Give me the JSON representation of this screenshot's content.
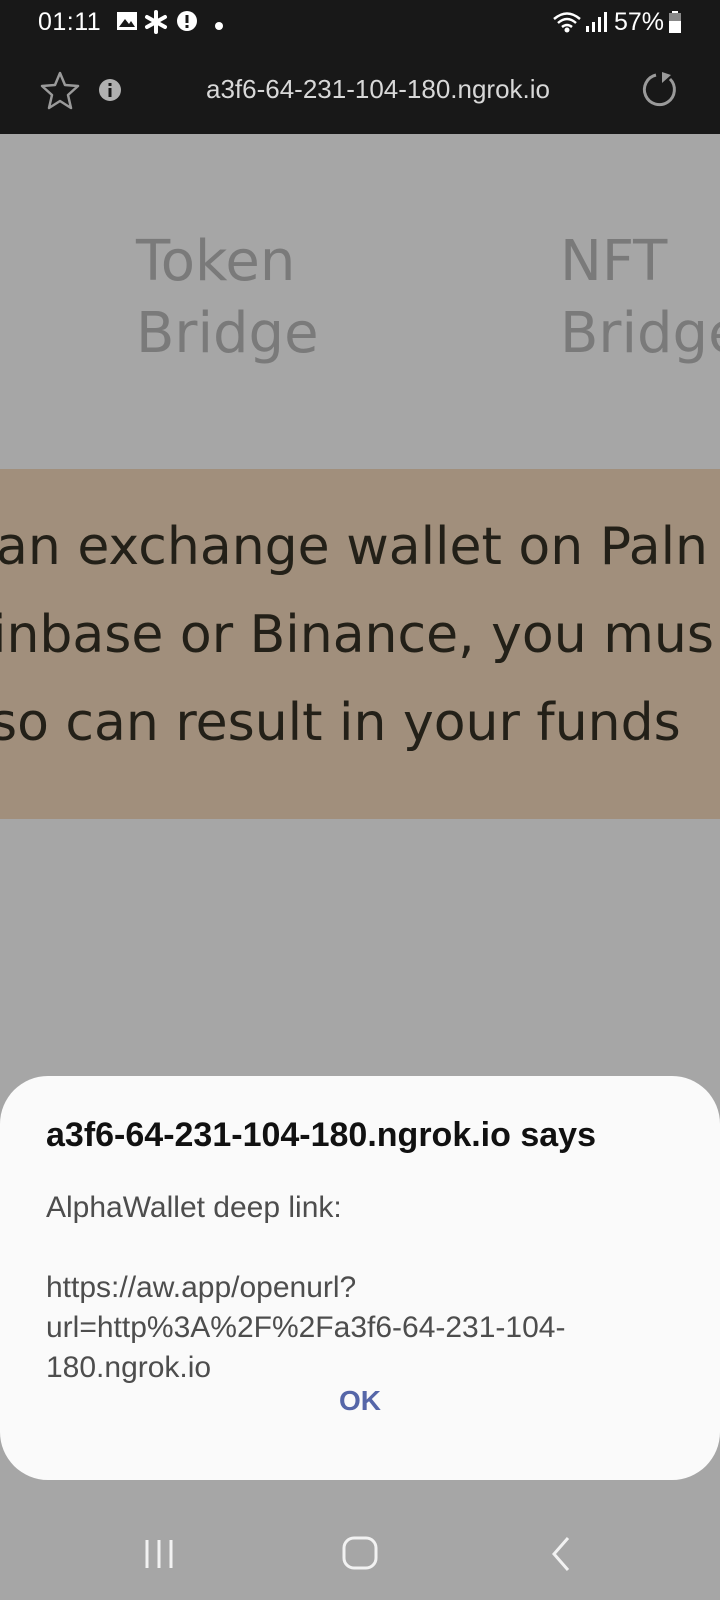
{
  "status_bar": {
    "time": "01:11",
    "battery": "57%",
    "icons": [
      "image-icon",
      "asterisk-icon",
      "alert-icon",
      "dot-icon",
      "wifi-icon",
      "signal-icon",
      "battery-icon"
    ]
  },
  "browser": {
    "url": "a3f6-64-231-104-180.ngrok.io",
    "icons": [
      "star-icon",
      "info-icon",
      "reload-icon"
    ]
  },
  "page": {
    "tabs": [
      {
        "line1": "Token",
        "line2": "Bridge"
      },
      {
        "line1": "NFT",
        "line2": "Bridge"
      }
    ],
    "warning_lines": [
      "an exchange wallet on Paln",
      "inbase or Binance, you mus",
      " so can result in your funds"
    ]
  },
  "dialog": {
    "title": "a3f6-64-231-104-180.ngrok.io says",
    "message": "AlphaWallet deep link:\n\nhttps://aw.app/openurl?url=http%3A%2F%2Fa3f6-64-231-104-180.ngrok.io",
    "ok_label": "OK"
  },
  "nav": {
    "icons": [
      "recents-icon",
      "home-icon",
      "back-icon"
    ]
  },
  "colors": {
    "toolbar": "#181818",
    "dialog_bg": "#fafafa",
    "ok": "#5566a8",
    "banner": "#a18f7c"
  }
}
